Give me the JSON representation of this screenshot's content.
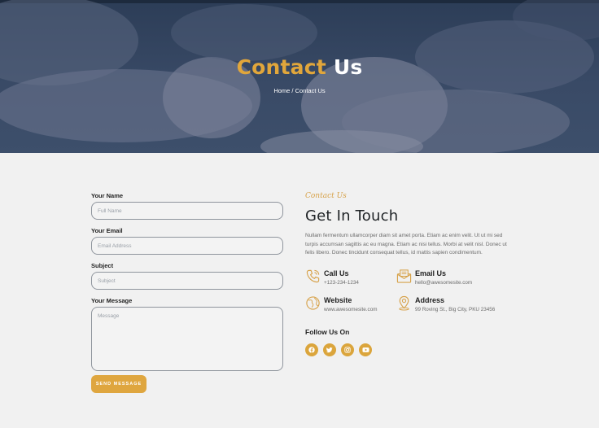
{
  "hero": {
    "title_accent": "Contact",
    "title_rest": "Us",
    "breadcrumb": "Home / Contact Us"
  },
  "form": {
    "name_label": "Your Name",
    "name_placeholder": "Full Name",
    "email_label": "Your Email",
    "email_placeholder": "Email Address",
    "subject_label": "Subject",
    "subject_placeholder": "Subject",
    "message_label": "Your Message",
    "message_placeholder": "Message",
    "send_label": "SEND MESSAGE"
  },
  "info": {
    "eyebrow": "Contact Us",
    "title": "Get In Touch",
    "description": "Nullam fermentum ullamcorper diam sit amet porta. Etiam ac enim velit. Ut ut mi sed turpis accumsan sagittis ac eu magna. Etiam ac nisi tellus. Morbi at velit nisl. Donec ut felis libero. Donec tincidunt consequat tellus, id mattis sapien condimentum.",
    "items": [
      {
        "title": "Call Us",
        "value": "+123-234-1234",
        "icon": "phone-icon"
      },
      {
        "title": "Email Us",
        "value": "hello@awesomesite.com",
        "icon": "email-icon"
      },
      {
        "title": "Website",
        "value": "www.awesomesite.com",
        "icon": "globe-icon"
      },
      {
        "title": "Address",
        "value": "99 Roving St., Big City, PKU 23456",
        "icon": "map-pin-icon"
      }
    ],
    "follow_label": "Follow Us On",
    "socials": [
      "facebook-icon",
      "twitter-icon",
      "instagram-icon",
      "youtube-icon"
    ]
  },
  "colors": {
    "accent": "#dfa63f",
    "hero_overlay": "#394a66",
    "background": "#f1f1f1"
  }
}
